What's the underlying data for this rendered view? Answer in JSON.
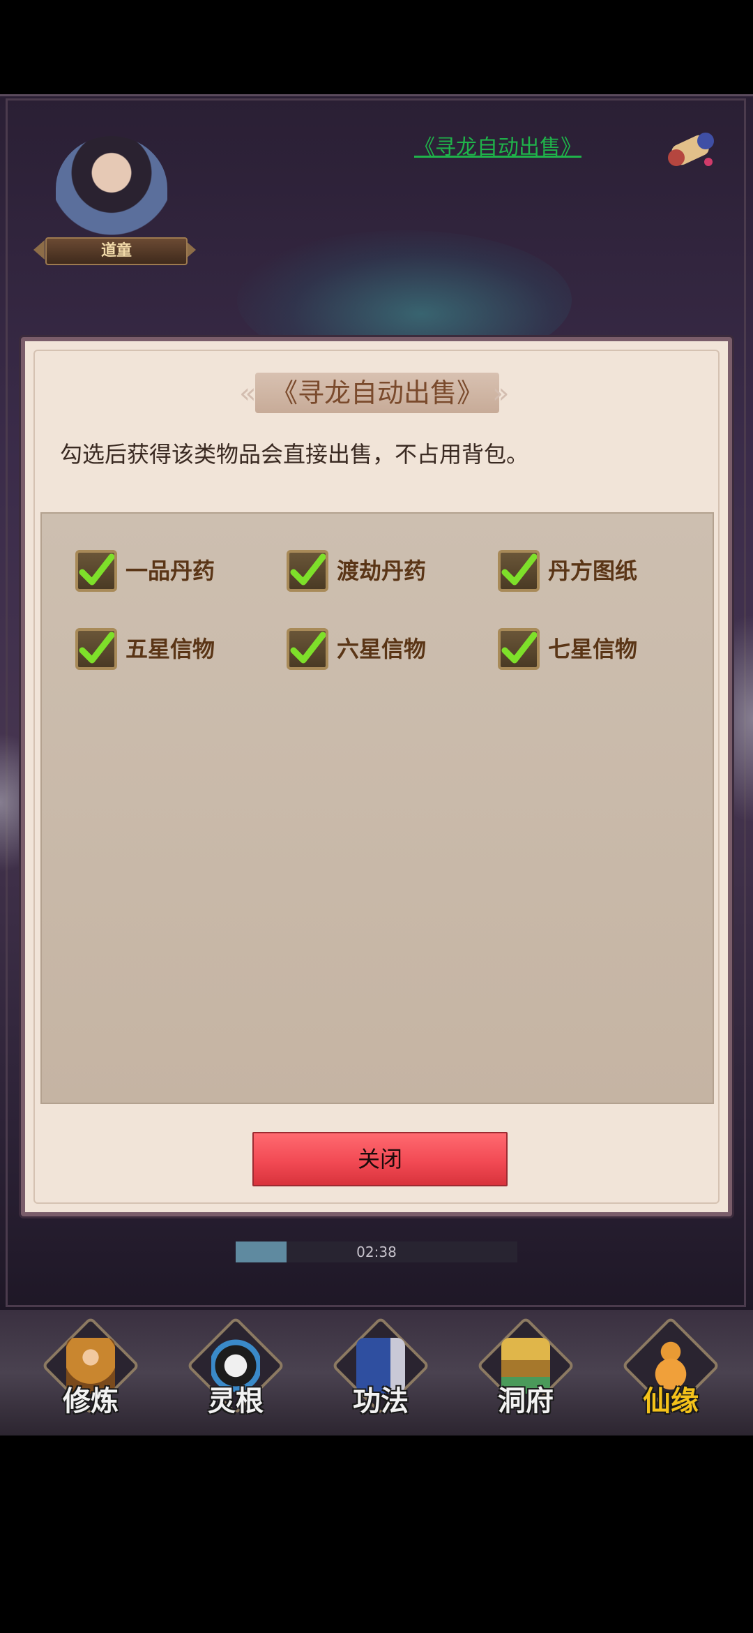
{
  "header": {
    "portrait_name": "道童",
    "top_link": "《寻龙自动出售》"
  },
  "dialog": {
    "title": "《寻龙自动出售》",
    "description": "勾选后获得该类物品会直接出售，不占用背包。",
    "options": [
      {
        "label": "一品丹药",
        "checked": true
      },
      {
        "label": "渡劫丹药",
        "checked": true
      },
      {
        "label": "丹方图纸",
        "checked": true
      },
      {
        "label": "五星信物",
        "checked": true
      },
      {
        "label": "六星信物",
        "checked": true
      },
      {
        "label": "七星信物",
        "checked": true
      }
    ],
    "close_label": "关闭"
  },
  "progress": {
    "time": "02:38",
    "fraction": 0.18
  },
  "bottom_nav": {
    "items": [
      {
        "label": "修炼",
        "icon": "monk-icon"
      },
      {
        "label": "灵根",
        "icon": "yin-yang-sword-icon"
      },
      {
        "label": "功法",
        "icon": "book-icon"
      },
      {
        "label": "洞府",
        "icon": "pavilion-icon"
      },
      {
        "label": "仙缘",
        "icon": "gourd-icon"
      }
    ]
  },
  "colors": {
    "accent_green_link": "#1fb34a",
    "check_green": "#7ee02a",
    "close_button_red": "#f24a54",
    "highlight_nav": "#f4c21a"
  }
}
